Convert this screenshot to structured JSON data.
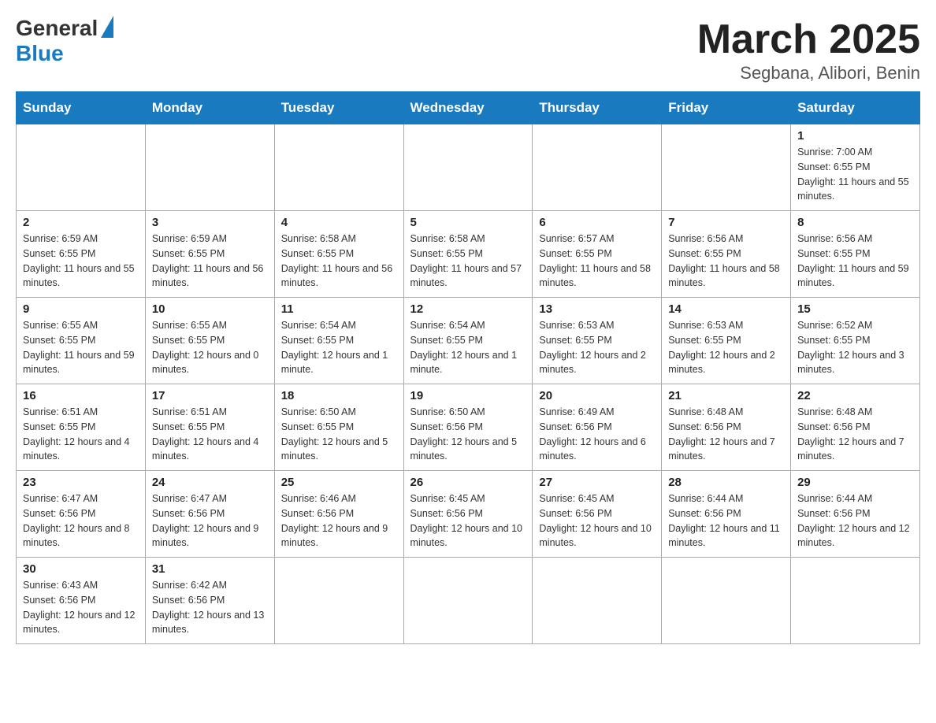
{
  "logo": {
    "general": "General",
    "blue": "Blue"
  },
  "header": {
    "month_year": "March 2025",
    "location": "Segbana, Alibori, Benin"
  },
  "days_of_week": [
    "Sunday",
    "Monday",
    "Tuesday",
    "Wednesday",
    "Thursday",
    "Friday",
    "Saturday"
  ],
  "weeks": [
    [
      {
        "day": "",
        "info": ""
      },
      {
        "day": "",
        "info": ""
      },
      {
        "day": "",
        "info": ""
      },
      {
        "day": "",
        "info": ""
      },
      {
        "day": "",
        "info": ""
      },
      {
        "day": "",
        "info": ""
      },
      {
        "day": "1",
        "info": "Sunrise: 7:00 AM\nSunset: 6:55 PM\nDaylight: 11 hours and 55 minutes."
      }
    ],
    [
      {
        "day": "2",
        "info": "Sunrise: 6:59 AM\nSunset: 6:55 PM\nDaylight: 11 hours and 55 minutes."
      },
      {
        "day": "3",
        "info": "Sunrise: 6:59 AM\nSunset: 6:55 PM\nDaylight: 11 hours and 56 minutes."
      },
      {
        "day": "4",
        "info": "Sunrise: 6:58 AM\nSunset: 6:55 PM\nDaylight: 11 hours and 56 minutes."
      },
      {
        "day": "5",
        "info": "Sunrise: 6:58 AM\nSunset: 6:55 PM\nDaylight: 11 hours and 57 minutes."
      },
      {
        "day": "6",
        "info": "Sunrise: 6:57 AM\nSunset: 6:55 PM\nDaylight: 11 hours and 58 minutes."
      },
      {
        "day": "7",
        "info": "Sunrise: 6:56 AM\nSunset: 6:55 PM\nDaylight: 11 hours and 58 minutes."
      },
      {
        "day": "8",
        "info": "Sunrise: 6:56 AM\nSunset: 6:55 PM\nDaylight: 11 hours and 59 minutes."
      }
    ],
    [
      {
        "day": "9",
        "info": "Sunrise: 6:55 AM\nSunset: 6:55 PM\nDaylight: 11 hours and 59 minutes."
      },
      {
        "day": "10",
        "info": "Sunrise: 6:55 AM\nSunset: 6:55 PM\nDaylight: 12 hours and 0 minutes."
      },
      {
        "day": "11",
        "info": "Sunrise: 6:54 AM\nSunset: 6:55 PM\nDaylight: 12 hours and 1 minute."
      },
      {
        "day": "12",
        "info": "Sunrise: 6:54 AM\nSunset: 6:55 PM\nDaylight: 12 hours and 1 minute."
      },
      {
        "day": "13",
        "info": "Sunrise: 6:53 AM\nSunset: 6:55 PM\nDaylight: 12 hours and 2 minutes."
      },
      {
        "day": "14",
        "info": "Sunrise: 6:53 AM\nSunset: 6:55 PM\nDaylight: 12 hours and 2 minutes."
      },
      {
        "day": "15",
        "info": "Sunrise: 6:52 AM\nSunset: 6:55 PM\nDaylight: 12 hours and 3 minutes."
      }
    ],
    [
      {
        "day": "16",
        "info": "Sunrise: 6:51 AM\nSunset: 6:55 PM\nDaylight: 12 hours and 4 minutes."
      },
      {
        "day": "17",
        "info": "Sunrise: 6:51 AM\nSunset: 6:55 PM\nDaylight: 12 hours and 4 minutes."
      },
      {
        "day": "18",
        "info": "Sunrise: 6:50 AM\nSunset: 6:55 PM\nDaylight: 12 hours and 5 minutes."
      },
      {
        "day": "19",
        "info": "Sunrise: 6:50 AM\nSunset: 6:56 PM\nDaylight: 12 hours and 5 minutes."
      },
      {
        "day": "20",
        "info": "Sunrise: 6:49 AM\nSunset: 6:56 PM\nDaylight: 12 hours and 6 minutes."
      },
      {
        "day": "21",
        "info": "Sunrise: 6:48 AM\nSunset: 6:56 PM\nDaylight: 12 hours and 7 minutes."
      },
      {
        "day": "22",
        "info": "Sunrise: 6:48 AM\nSunset: 6:56 PM\nDaylight: 12 hours and 7 minutes."
      }
    ],
    [
      {
        "day": "23",
        "info": "Sunrise: 6:47 AM\nSunset: 6:56 PM\nDaylight: 12 hours and 8 minutes."
      },
      {
        "day": "24",
        "info": "Sunrise: 6:47 AM\nSunset: 6:56 PM\nDaylight: 12 hours and 9 minutes."
      },
      {
        "day": "25",
        "info": "Sunrise: 6:46 AM\nSunset: 6:56 PM\nDaylight: 12 hours and 9 minutes."
      },
      {
        "day": "26",
        "info": "Sunrise: 6:45 AM\nSunset: 6:56 PM\nDaylight: 12 hours and 10 minutes."
      },
      {
        "day": "27",
        "info": "Sunrise: 6:45 AM\nSunset: 6:56 PM\nDaylight: 12 hours and 10 minutes."
      },
      {
        "day": "28",
        "info": "Sunrise: 6:44 AM\nSunset: 6:56 PM\nDaylight: 12 hours and 11 minutes."
      },
      {
        "day": "29",
        "info": "Sunrise: 6:44 AM\nSunset: 6:56 PM\nDaylight: 12 hours and 12 minutes."
      }
    ],
    [
      {
        "day": "30",
        "info": "Sunrise: 6:43 AM\nSunset: 6:56 PM\nDaylight: 12 hours and 12 minutes."
      },
      {
        "day": "31",
        "info": "Sunrise: 6:42 AM\nSunset: 6:56 PM\nDaylight: 12 hours and 13 minutes."
      },
      {
        "day": "",
        "info": ""
      },
      {
        "day": "",
        "info": ""
      },
      {
        "day": "",
        "info": ""
      },
      {
        "day": "",
        "info": ""
      },
      {
        "day": "",
        "info": ""
      }
    ]
  ]
}
